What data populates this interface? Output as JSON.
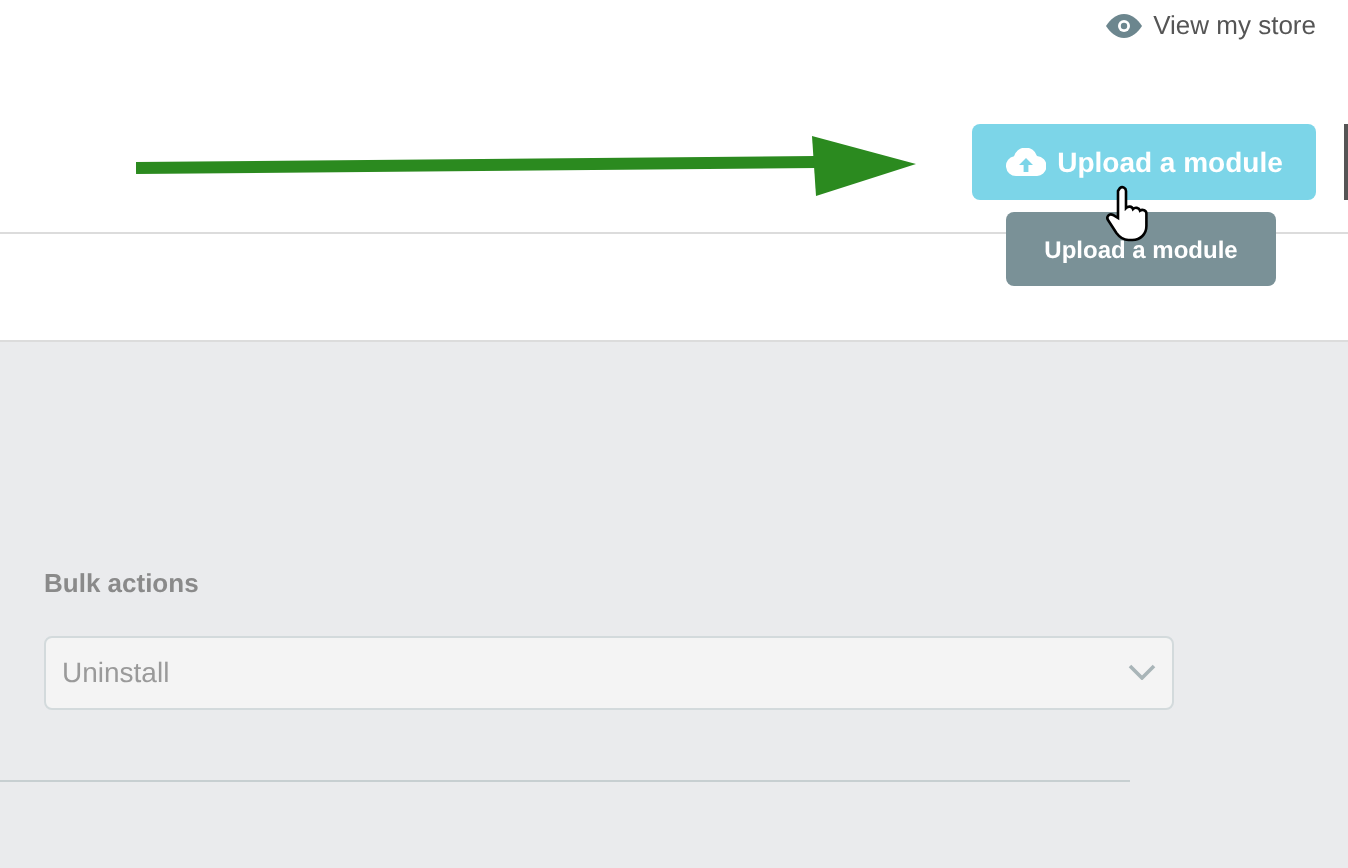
{
  "header": {
    "view_store_link": "View my store",
    "upload_button": {
      "label": "Upload a module",
      "tooltip": "Upload a module"
    }
  },
  "bulk_actions": {
    "label": "Bulk actions",
    "select": {
      "value": "Uninstall",
      "disabled": true
    }
  }
}
